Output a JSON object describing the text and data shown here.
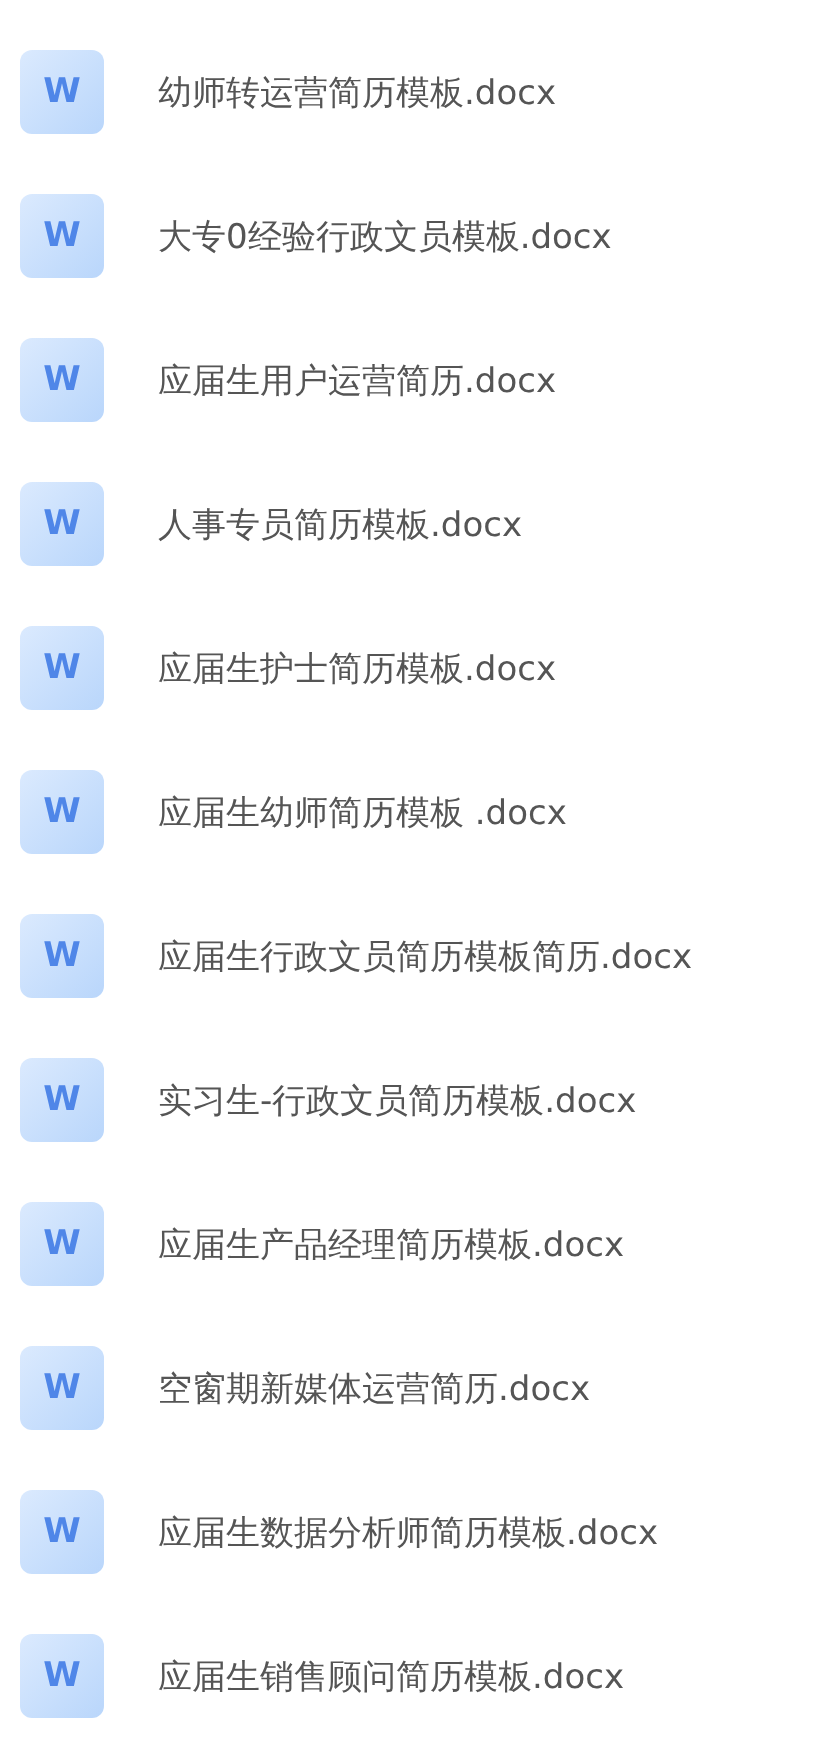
{
  "files": [
    {
      "icon": "W",
      "name": "幼师转运营简历模板.docx"
    },
    {
      "icon": "W",
      "name": "大专0经验行政文员模板.docx"
    },
    {
      "icon": "W",
      "name": "应届生用户运营简历.docx"
    },
    {
      "icon": "W",
      "name": "人事专员简历模板.docx"
    },
    {
      "icon": "W",
      "name": "应届生护士简历模板.docx"
    },
    {
      "icon": "W",
      "name": "应届生幼师简历模板 .docx"
    },
    {
      "icon": "W",
      "name": "应届生行政文员简历模板简历.docx"
    },
    {
      "icon": "W",
      "name": "实习生-行政文员简历模板.docx"
    },
    {
      "icon": "W",
      "name": "应届生产品经理简历模板.docx"
    },
    {
      "icon": "W",
      "name": "空窗期新媒体运营简历.docx"
    },
    {
      "icon": "W",
      "name": "应届生数据分析师简历模板.docx"
    },
    {
      "icon": "W",
      "name": "应届生销售顾问简历模板.docx"
    }
  ]
}
